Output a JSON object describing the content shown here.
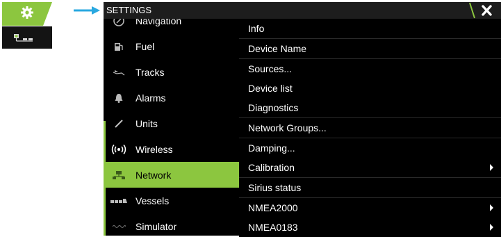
{
  "window": {
    "title": "SETTINGS",
    "close_icon": "close-icon"
  },
  "thumbnails": [
    {
      "name": "settings-tile",
      "icon": "gear-icon",
      "color": "#8cc63f"
    },
    {
      "name": "network-tile",
      "icon": "network-icon"
    }
  ],
  "sidebar": {
    "items": [
      {
        "label": "Navigation",
        "icon": "compass-icon"
      },
      {
        "label": "Fuel",
        "icon": "fuel-pump-icon"
      },
      {
        "label": "Tracks",
        "icon": "tracks-icon"
      },
      {
        "label": "Alarms",
        "icon": "bell-icon"
      },
      {
        "label": "Units",
        "icon": "pen-icon"
      },
      {
        "label": "Wireless",
        "icon": "wireless-icon"
      },
      {
        "label": "Network",
        "icon": "network-icon",
        "active": true
      },
      {
        "label": "Vessels",
        "icon": "vessels-icon"
      },
      {
        "label": "Simulator",
        "icon": "simulator-icon"
      }
    ]
  },
  "network_menu": {
    "items": [
      {
        "label": "Info",
        "submenu": false
      },
      {
        "label": "Device Name",
        "submenu": false
      },
      {
        "label": "Sources...",
        "submenu": false
      },
      {
        "label": "Device list",
        "submenu": false
      },
      {
        "label": "Diagnostics",
        "submenu": false
      },
      {
        "label": "Network Groups...",
        "submenu": false
      },
      {
        "label": "Damping...",
        "submenu": false
      },
      {
        "label": "Calibration",
        "submenu": true
      },
      {
        "label": "Sirius status",
        "submenu": false
      },
      {
        "label": "NMEA2000",
        "submenu": true
      },
      {
        "label": "NMEA0183",
        "submenu": true
      }
    ]
  },
  "colors": {
    "accent": "#8cc63f",
    "arrow": "#29a8e0",
    "background": "#000000",
    "text": "#ffffff"
  }
}
